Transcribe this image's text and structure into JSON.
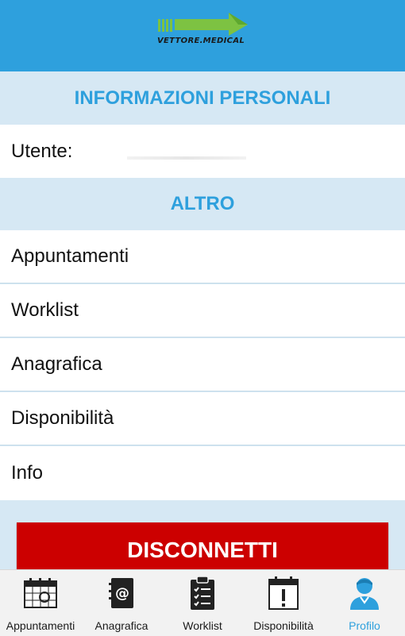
{
  "header": {
    "logo_text": "VETTORE.MEDICAL"
  },
  "sections": {
    "personal": {
      "title": "INFORMAZIONI PERSONALI",
      "user_label": "Utente:"
    },
    "other": {
      "title": "ALTRO",
      "items": [
        "Appuntamenti",
        "Worklist",
        "Anagrafica",
        "Disponibilità",
        "Info"
      ]
    }
  },
  "logout_label": "DISCONNETTI",
  "tabbar": {
    "tabs": [
      {
        "label": "Appuntamenti",
        "icon": "calendar-icon"
      },
      {
        "label": "Anagrafica",
        "icon": "address-book-icon"
      },
      {
        "label": "Worklist",
        "icon": "clipboard-checklist-icon"
      },
      {
        "label": "Disponibilità",
        "icon": "calendar-alert-icon"
      },
      {
        "label": "Profilo",
        "icon": "user-profile-icon"
      }
    ],
    "active": "Profilo"
  },
  "colors": {
    "primary": "#2ea0dd",
    "section_bg": "#d6e8f4",
    "danger": "#cc0000",
    "logo_green": "#7dc242"
  }
}
